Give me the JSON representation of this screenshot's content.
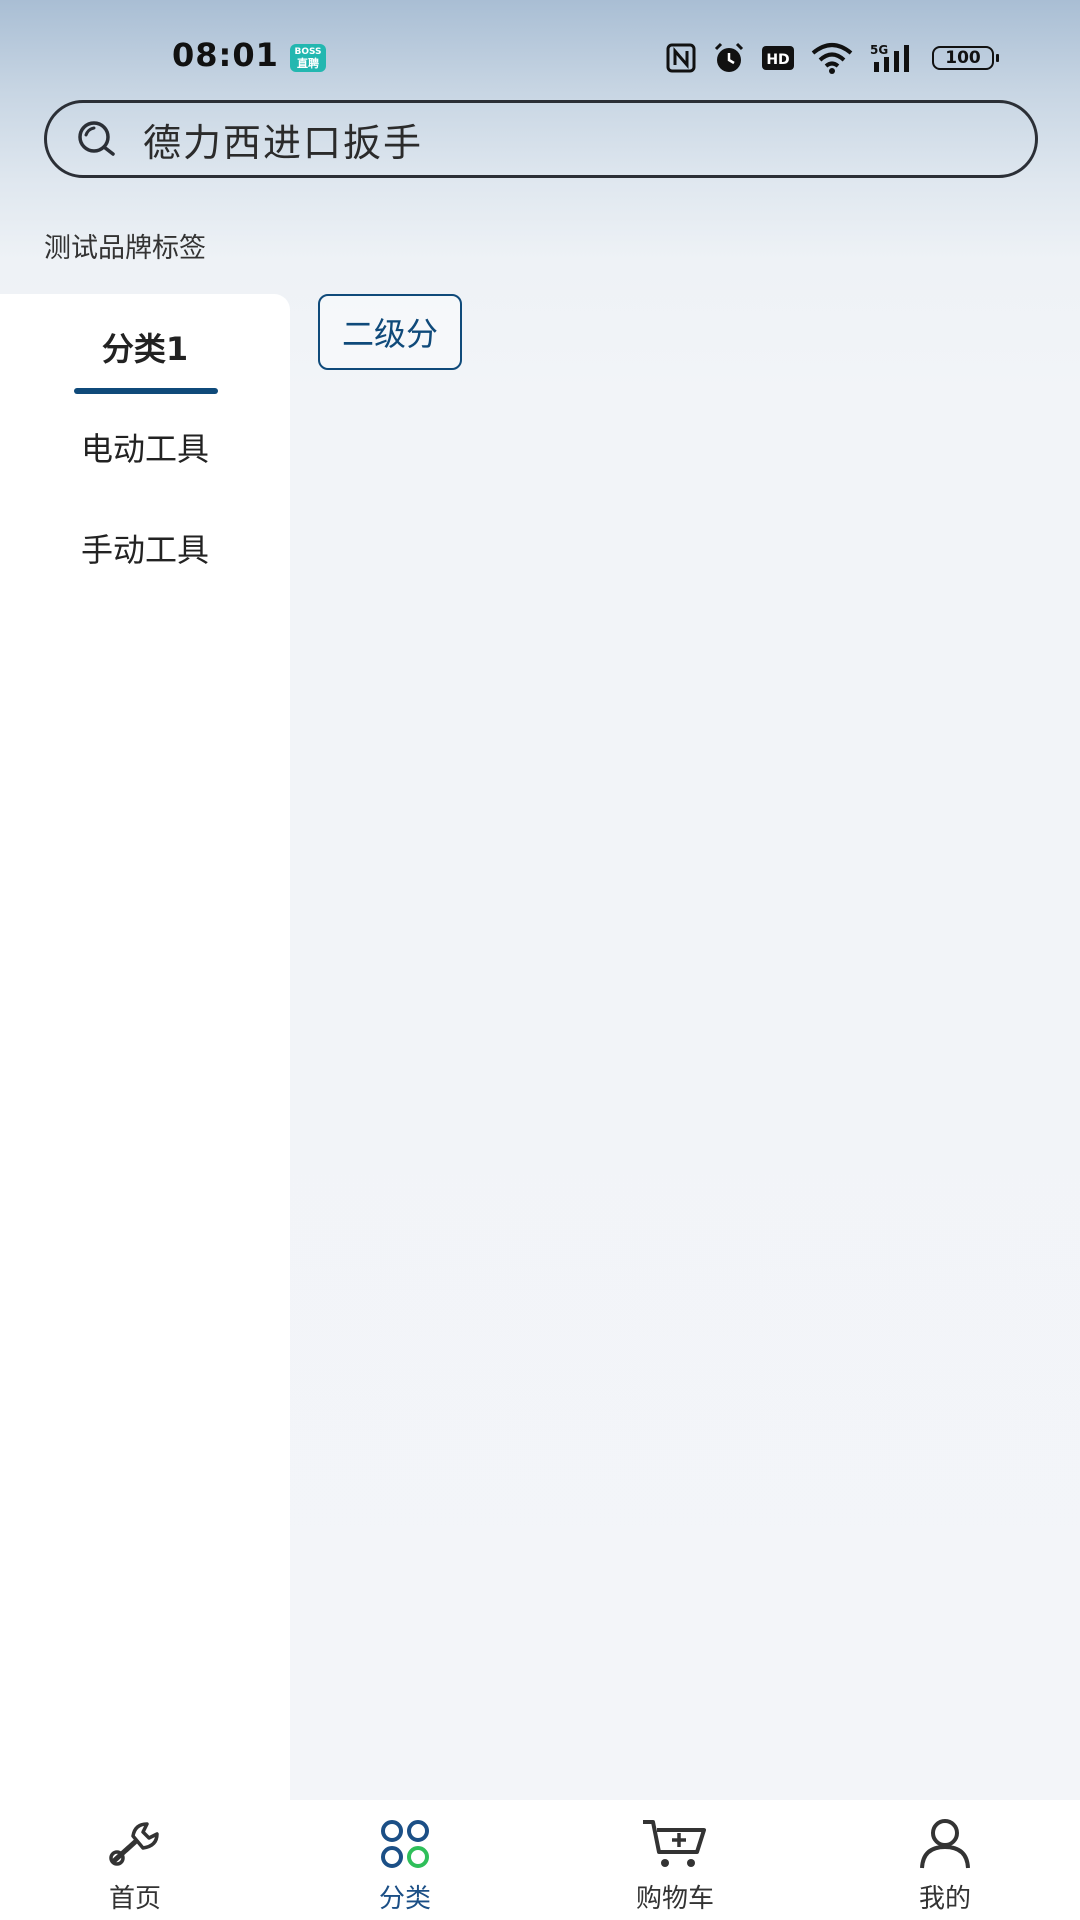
{
  "status_bar": {
    "time": "08:01",
    "badge_top": "BOSS",
    "badge_bottom": "直聘",
    "battery": "100"
  },
  "search": {
    "value": "德力西进口扳手",
    "icon": "search-icon"
  },
  "brand_tag": "测试品牌标签",
  "categories": [
    {
      "label": "分类1",
      "active": true
    },
    {
      "label": "电动工具",
      "active": false
    },
    {
      "label": "手动工具",
      "active": false
    }
  ],
  "sub_category": "二级分",
  "tabs": [
    {
      "label": "首页",
      "icon": "wrench-icon",
      "active": false
    },
    {
      "label": "分类",
      "icon": "category-grid-icon",
      "active": true
    },
    {
      "label": "购物车",
      "icon": "cart-icon",
      "active": false
    },
    {
      "label": "我的",
      "icon": "user-icon",
      "active": false
    }
  ],
  "colors": {
    "accent": "#0f4a7a",
    "category_green": "#2fbf5a",
    "badge": "#23b7b0"
  }
}
